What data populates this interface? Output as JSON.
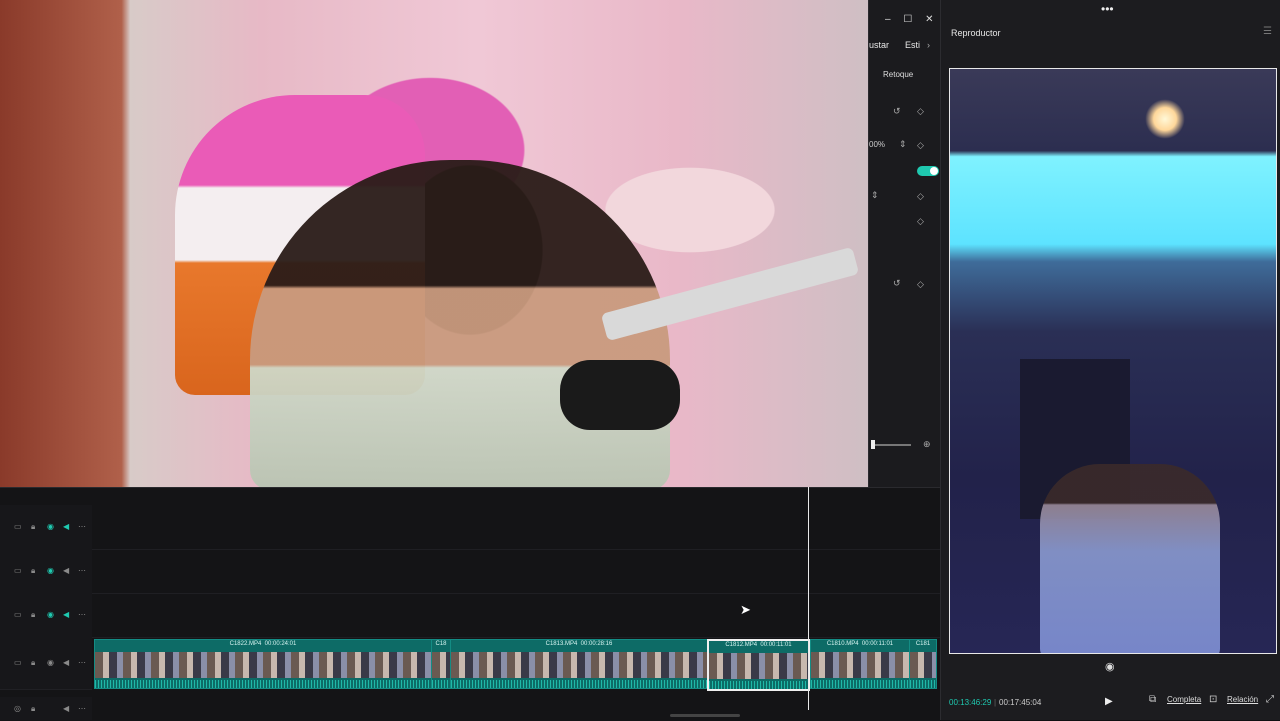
{
  "window": {
    "more_icon": "more-horizontal-icon",
    "buttons": [
      "–",
      "☐",
      "✕"
    ]
  },
  "properties_panel": {
    "tabs": [
      "ustar",
      "Esti"
    ],
    "retoque_label": "Retoque",
    "scale_value": "00%"
  },
  "player": {
    "title": "Reproductor",
    "current_time": "00:13:46:29",
    "total_time": "00:17:45:04",
    "full_label": "Completa",
    "ratio_label": "Relación"
  },
  "timeline": {
    "tracks": [
      "track-1",
      "track-2",
      "track-3",
      "track-video-main",
      "track-audio"
    ],
    "clips": [
      {
        "name": "C1822.MP4",
        "duration": "00:00:24:01"
      },
      {
        "name": "C18",
        "duration": ""
      },
      {
        "name": "C1813.MP4",
        "duration": "00:00:28:16"
      },
      {
        "name": "C1812.MP4",
        "duration": "00:00:11:01"
      },
      {
        "name": "C1810.MP4",
        "duration": "00:00:11:01"
      },
      {
        "name": "C181",
        "duration": ""
      }
    ]
  }
}
